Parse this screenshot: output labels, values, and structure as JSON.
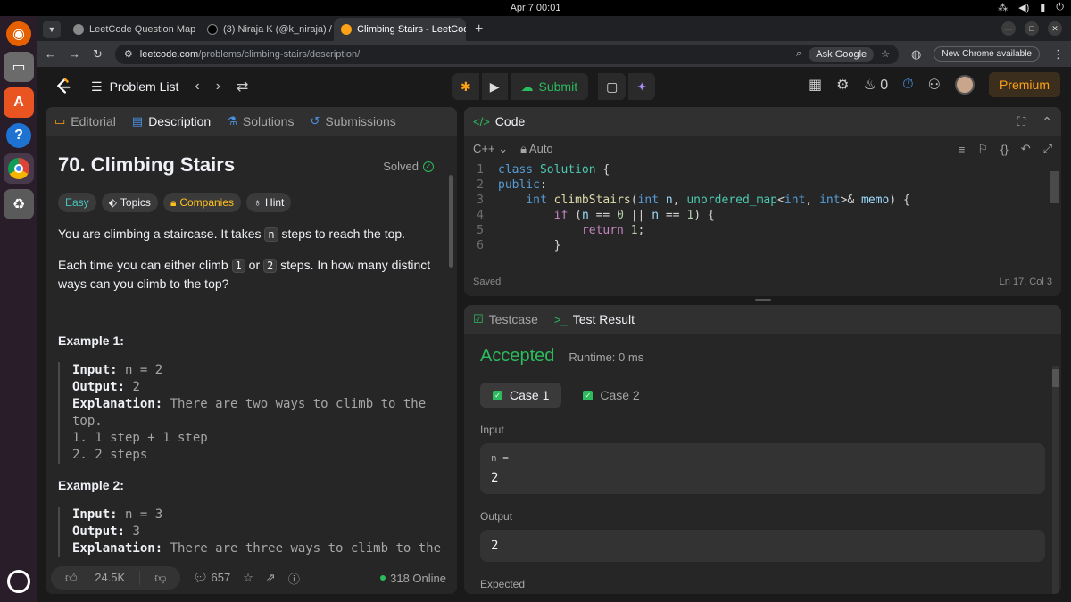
{
  "os": {
    "datetime": "Apr 7  00:01"
  },
  "browser": {
    "tabs": [
      {
        "title": "LeetCode Question Map"
      },
      {
        "title": "(3) Niraja K (@k_niraja) /"
      },
      {
        "title": "Climbing Stairs - LeetCode",
        "active": true
      }
    ],
    "url_host": "leetcode.com",
    "url_path": "/problems/climbing-stairs/description/",
    "ask_google": "Ask Google",
    "update_label": "New Chrome available"
  },
  "nav": {
    "problem_list": "Problem List",
    "submit": "Submit",
    "streak": "0",
    "premium": "Premium"
  },
  "left": {
    "tabs": [
      "Editorial",
      "Description",
      "Solutions",
      "Submissions"
    ],
    "title": "70. Climbing Stairs",
    "solved": "Solved",
    "tags": [
      "Easy",
      "Topics",
      "Companies",
      "Hint"
    ],
    "para1_a": "You are climbing a staircase. It takes ",
    "para1_code": "n",
    "para1_b": " steps to reach the top.",
    "para2_a": "Each time you can either climb ",
    "para2_code1": "1",
    "para2_mid": " or ",
    "para2_code2": "2",
    "para2_b": " steps. In how many distinct ways can you climb to the top?",
    "example1_title": "Example 1:",
    "example1": {
      "input_label": "Input:",
      "input": " n = 2",
      "output_label": "Output:",
      "output": " 2",
      "expl_label": "Explanation:",
      "expl": " There are two ways to climb to the top.",
      "steps": [
        "1. 1 step + 1 step",
        "2. 2 steps"
      ]
    },
    "example2_title": "Example 2:",
    "example2": {
      "input_label": "Input:",
      "input": " n = 3",
      "output_label": "Output:",
      "output": " 3",
      "expl_label": "Explanation:",
      "expl": " There are three ways to climb to the"
    },
    "likes": "24.5K",
    "comments": "657",
    "online": "318 Online"
  },
  "code": {
    "header": "Code",
    "language": "C++",
    "mode": "Auto",
    "status_left": "Saved",
    "status_right": "Ln 17, Col 3"
  },
  "result": {
    "tabs": [
      "Testcase",
      "Test Result"
    ],
    "verdict": "Accepted",
    "runtime": "Runtime: 0 ms",
    "cases": [
      "Case 1",
      "Case 2"
    ],
    "input_label": "Input",
    "input_var": "n =",
    "input_value": "2",
    "output_label": "Output",
    "output_value": "2",
    "expected_label": "Expected"
  },
  "colors": {
    "accent_green": "#2cbb5d",
    "premium_orange": "#ffa116",
    "easy_teal": "#46c6c2"
  }
}
